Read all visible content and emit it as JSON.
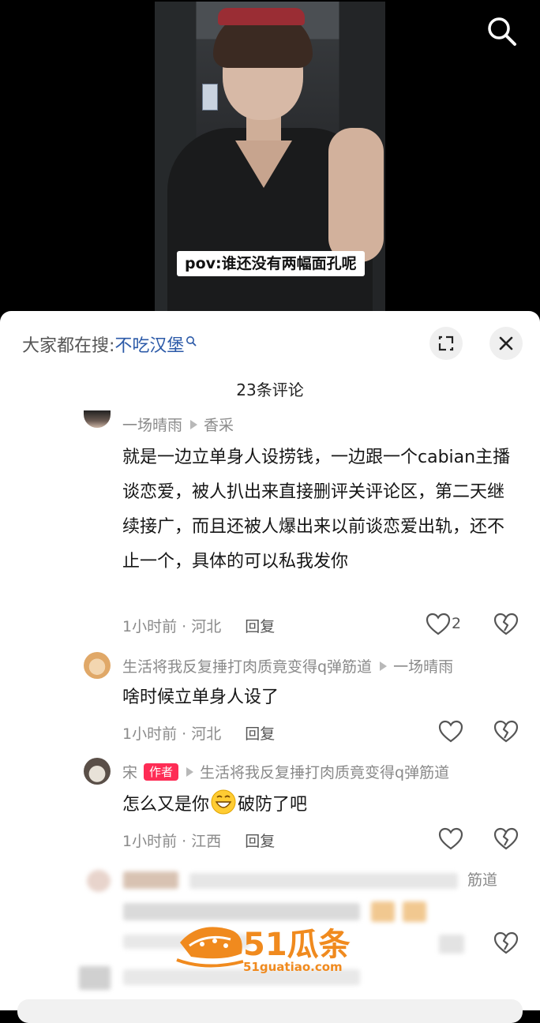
{
  "video": {
    "caption": "pov:谁还没有两幅面孔呢",
    "search_icon": "search-icon"
  },
  "panel": {
    "search_prefix": "大家都在搜:",
    "search_keyword": "不吃汉堡",
    "expand_icon": "expand-icon",
    "close_icon": "close-icon",
    "comment_count": "23条评论"
  },
  "comments": [
    {
      "user": "一场晴雨",
      "reply_to": "香采",
      "text": "就是一边立单身人设捞钱，一边跟一个cabian主播谈恋爱，被人扒出来直接删评关评论区，第二天继续接广，而且还被人爆出来以前谈恋爱出轨，还不止一个，具体的可以私我发你",
      "time_loc": "1小时前 · 河北",
      "reply_label": "回复",
      "likes": "2"
    },
    {
      "user": "生活将我反复捶打肉质竟变得q弹筋道",
      "reply_to": "一场晴雨",
      "text": "啥时候立单身人设了",
      "time_loc": "1小时前 · 河北",
      "reply_label": "回复",
      "likes": ""
    },
    {
      "user": "宋",
      "badge": "作者",
      "reply_to": "生活将我反复捶打肉质竟变得q弹筋道",
      "text_before": "怎么又是你",
      "emoji": "grinning-emoji",
      "text_after": "破防了吧",
      "time_loc": "1小时前 · 江西",
      "reply_label": "回复",
      "likes": ""
    }
  ],
  "blurred": {
    "visible_fragment": "筋道"
  },
  "watermark": {
    "brand": "51瓜条",
    "site": "51guatiao.com"
  },
  "colors": {
    "accent_red": "#fe2c55",
    "keyword_blue": "#2c5aa8",
    "watermark_orange": "#f08a1e"
  }
}
